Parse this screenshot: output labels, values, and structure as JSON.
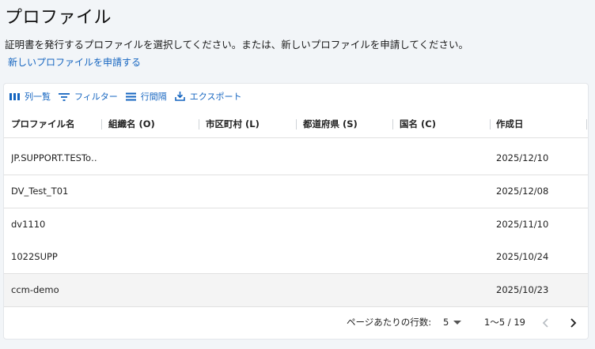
{
  "page": {
    "title": "プロファイル",
    "description": "証明書を発行するプロファイルを選択してください。または、新しいプロファイルを申請してください。",
    "apply_link": "新しいプロファイルを申請する"
  },
  "toolbar": {
    "columns_label": "列一覧",
    "filter_label": "フィルター",
    "density_label": "行間隔",
    "export_label": "エクスポート"
  },
  "table": {
    "headers": {
      "profile_name": "プロファイル名",
      "organization": "組織名 (O)",
      "locality": "市区町村 (L)",
      "state": "都道府県 (S)",
      "country": "国名 (C)",
      "created": "作成日"
    },
    "rows": [
      {
        "profile_name": "JP.SUPPORT.TESTo…",
        "organization": "",
        "locality": "",
        "state": "",
        "country": "",
        "created": "2025/12/10"
      },
      {
        "profile_name": "DV_Test_T01",
        "organization": "",
        "locality": "",
        "state": "",
        "country": "",
        "created": "2025/12/08"
      },
      {
        "profile_name": "dv1110",
        "organization": "",
        "locality": "",
        "state": "",
        "country": "",
        "created": "2025/11/10"
      },
      {
        "profile_name": "1022SUPP",
        "organization": "",
        "locality": "",
        "state": "",
        "country": "",
        "created": "2025/10/24"
      },
      {
        "profile_name": "ccm-demo",
        "organization": "",
        "locality": "",
        "state": "",
        "country": "",
        "created": "2025/10/23"
      }
    ]
  },
  "pagination": {
    "rows_per_page_label": "ページあたりの行数:",
    "rows_per_page_value": "5",
    "range": "1〜5 / 19"
  },
  "colors": {
    "accent": "#1565c0",
    "background": "#f2f5f8",
    "hover_row": "#f4f4f4"
  }
}
